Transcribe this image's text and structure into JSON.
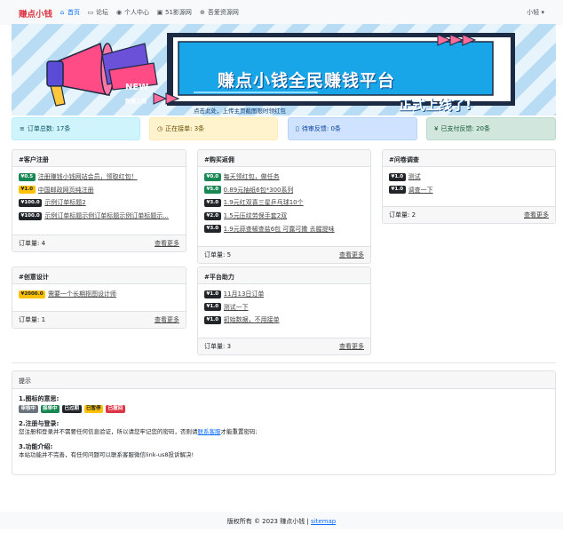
{
  "nav": {
    "brand": "赚点小钱",
    "items": [
      {
        "label": "首页",
        "icon": "house-icon",
        "active": true
      },
      {
        "label": "论坛",
        "icon": "chat-icon",
        "active": false
      },
      {
        "label": "个人中心",
        "icon": "person-icon",
        "active": false
      },
      {
        "label": "51影源网",
        "icon": "film-icon",
        "active": false
      },
      {
        "label": "吾爱资源网",
        "icon": "globe-icon",
        "active": false
      }
    ],
    "user": "小轻 ▾"
  },
  "banner": {
    "title": "赚点小钱全民赚钱平台",
    "subtitle": "点击此处，上传主页截图限时领红包",
    "slogan": "正式上线了!",
    "new_tag": "NEW",
    "hot_tag": "新版上线"
  },
  "stats": [
    {
      "label": "订单总数: 17条",
      "icon": "list-icon",
      "bg": "#cff4fc",
      "fg": "#055160"
    },
    {
      "label": "正在接单: 3条",
      "icon": "clock-icon",
      "bg": "#fff3cd",
      "fg": "#664d03"
    },
    {
      "label": "待审反馈: 0条",
      "icon": "doc-icon",
      "bg": "#cfe2ff",
      "fg": "#084298"
    },
    {
      "label": "已支付反馈: 20条",
      "icon": "yen-icon",
      "bg": "#d1e7dd",
      "fg": "#0f5132"
    }
  ],
  "cards": {
    "register": {
      "title": "#客户注册",
      "rows": [
        {
          "badge": "¥0.5",
          "text": "注册赚钱小钱网站会员，领取红包！"
        },
        {
          "badge": "¥1.0",
          "text": "中国邮政网页纯注册"
        },
        {
          "badge": "¥100.0",
          "text": "示例订单标题2"
        },
        {
          "badge": "¥100.0",
          "text": "示例订单标题示例订单标题示例订单标题示..."
        }
      ],
      "count": "订单量: 4",
      "more": "查看更多"
    },
    "purchase": {
      "title": "#购买返佣",
      "rows": [
        {
          "badge": "¥0.0",
          "text": "每天领红包，做任务"
        },
        {
          "badge": "¥5.0",
          "text": "0.89元抽纸6包*300系列"
        },
        {
          "badge": "¥3.0",
          "text": "1.9元红双喜三星乒乓球10个"
        },
        {
          "badge": "¥2.0",
          "text": "1.5元压纹劳保手套2双"
        },
        {
          "badge": "¥3.0",
          "text": "1.9元蒜查椒查盐6包 可露可撒 去腥提味"
        }
      ],
      "count": "订单量: 5",
      "more": "查看更多"
    },
    "survey": {
      "title": "#问卷调查",
      "rows": [
        {
          "badge": "¥1.0",
          "text": "测试"
        },
        {
          "badge": "¥1.0",
          "text": "调查一下"
        }
      ],
      "count": "订单量: 2",
      "more": "查看更多"
    },
    "design": {
      "title": "#创意设计",
      "rows": [
        {
          "badge": "¥2000.0",
          "text": "需要一个长期抠图设计师"
        }
      ],
      "count": "订单量: 1",
      "more": "查看更多"
    },
    "boost": {
      "title": "#平台助力",
      "rows": [
        {
          "badge": "¥1.0",
          "text": "11月13日订单"
        },
        {
          "badge": "¥1.0",
          "text": "测试一下"
        },
        {
          "badge": "¥1.0",
          "text": "初始数据，不用接单"
        }
      ],
      "count": "订单量: 3",
      "more": "查看更多"
    }
  },
  "tips": {
    "header": "提示",
    "s1_title": "1.图标的意思:",
    "legend": [
      {
        "label": "审核中",
        "class": "b-gray"
      },
      {
        "label": "接单中",
        "class": "b-green"
      },
      {
        "label": "已过期",
        "class": "b-dark"
      },
      {
        "label": "已暂停",
        "class": "b-yellow"
      },
      {
        "label": "已撤回",
        "class": "b-red"
      }
    ],
    "s2_title": "2.注册与登录:",
    "s2_pre": "您注册和登录并不需要任何信息验证，所以请您牢记您的密码，否则请",
    "s2_link": "联系客服",
    "s2_post": "才能重置密码;",
    "s3_title": "3.功能介绍:",
    "s3_text": "本站功能并不完善，有任何问题可以联系客服微信link-us8投诉解决!"
  },
  "footer": {
    "text": "版权所有 © 2023 赚点小钱 | ",
    "sitemap": "sitemap"
  }
}
